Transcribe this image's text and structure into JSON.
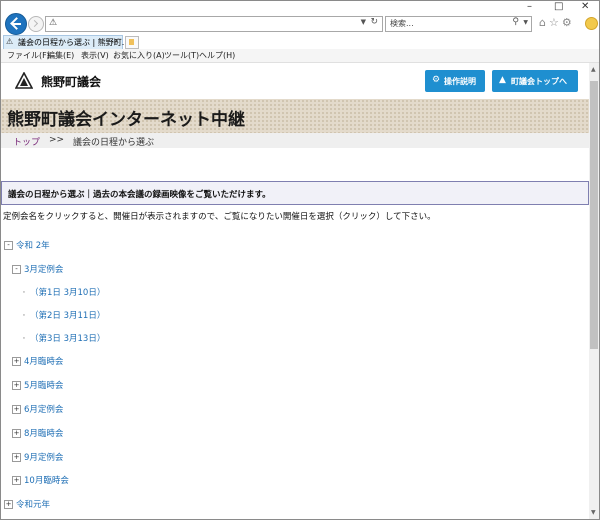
{
  "browser": {
    "window_controls": [
      "–",
      "□",
      "✕"
    ],
    "address_warning": "⚠",
    "search_placeholder": "検索...",
    "tab": {
      "label": "議会の日程から選ぶ | 熊野町...",
      "close": "×"
    },
    "menu": [
      "ファイル(F)",
      "編集(E)",
      "表示(V)",
      "お気に入り(A)",
      "ツール(T)",
      "ヘルプ(H)"
    ]
  },
  "site": {
    "name": "熊野町議会",
    "buttons": {
      "guide": "操作説明",
      "top": "町議会トップへ"
    },
    "banner_title": "熊野町議会インターネット中継",
    "breadcrumb": {
      "top": "トップ",
      "sep": ">>",
      "current": "議会の日程から選ぶ"
    },
    "notice": "議会の日程から選ぶ｜過去の本会議の録画映像をご覧いただけます。",
    "instruction": "定例会名をクリックすると、開催日が表示されますので、ご覧になりたい開催日を選択（クリック）して下さい。"
  },
  "tree": {
    "year1": "令和 2年",
    "session_open": "3月定例会",
    "days": [
      "（第1日 3月10日）",
      "（第2日 3月11日）",
      "（第3日 3月13日）"
    ],
    "sessions": [
      "4月臨時会",
      "5月臨時会",
      "6月定例会",
      "8月臨時会",
      "9月定例会",
      "10月臨時会"
    ],
    "year2": "令和元年"
  },
  "colors": {
    "accent_button": "#1f8fd0",
    "link": "#1f6fb5",
    "breadcrumb_link": "#7a2a7a"
  }
}
